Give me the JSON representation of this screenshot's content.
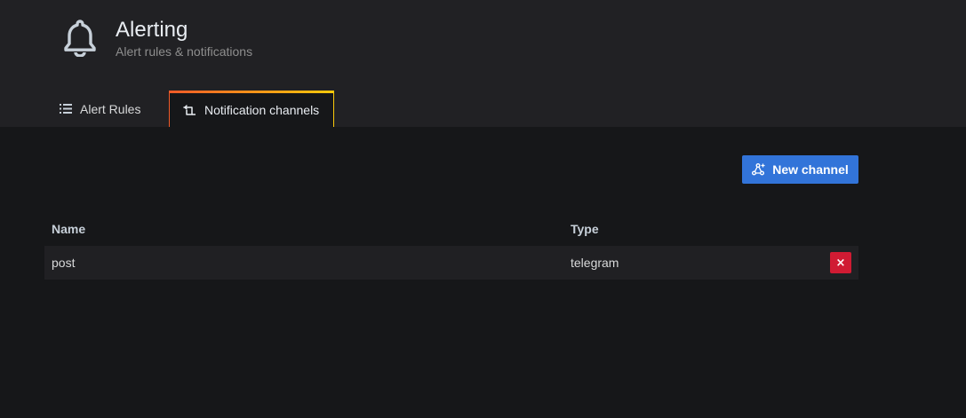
{
  "header": {
    "title": "Alerting",
    "subtitle": "Alert rules & notifications",
    "icon": "bell-icon"
  },
  "tabs": [
    {
      "label": "Alert Rules",
      "icon": "list-icon",
      "active": false
    },
    {
      "label": "Notification channels",
      "icon": "channel-icon",
      "active": true
    }
  ],
  "toolbar": {
    "new_channel_label": "New channel",
    "new_channel_icon": "share-icon"
  },
  "table": {
    "columns": [
      "Name",
      "Type"
    ],
    "rows": [
      {
        "name": "post",
        "type": "telegram",
        "delete_icon": "close-icon",
        "delete_glyph": "×"
      }
    ]
  },
  "colors": {
    "primary_button": "#3274d9",
    "danger_button": "#d01b33",
    "tab_accent_start": "#f05a28",
    "tab_accent_end": "#fbca0a"
  }
}
